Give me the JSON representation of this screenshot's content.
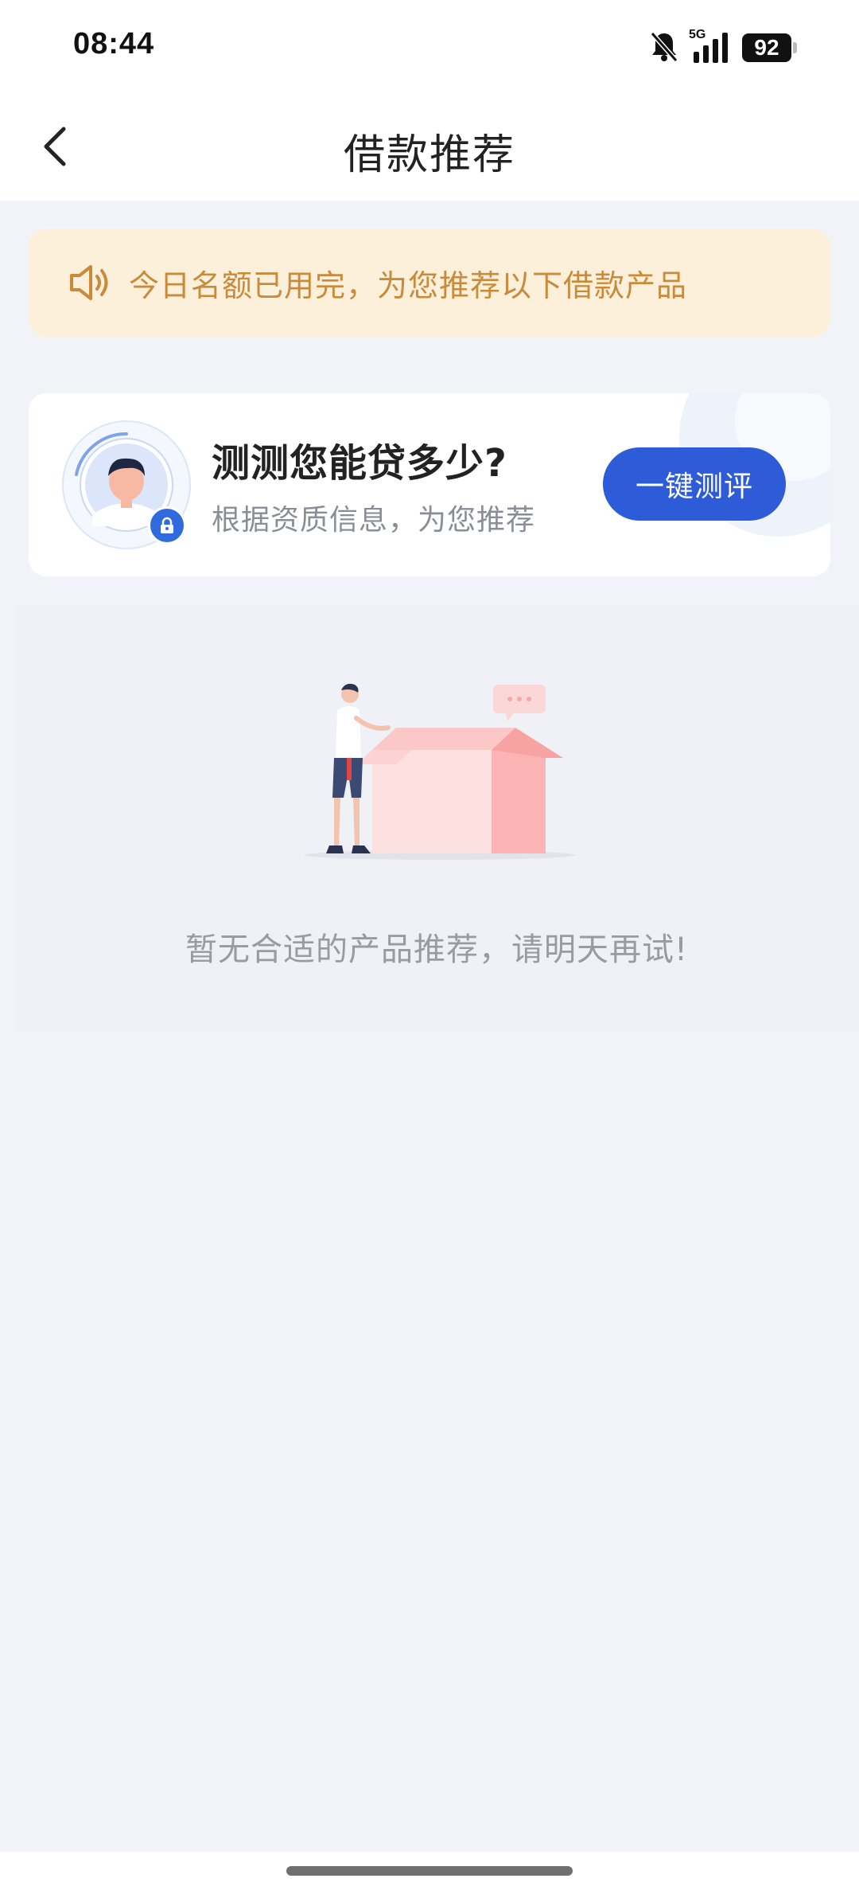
{
  "status_bar": {
    "time": "08:44",
    "network": "5G",
    "battery": "92",
    "icons": [
      "bell-muted-icon",
      "signal-icon",
      "battery-icon"
    ]
  },
  "nav": {
    "title": "借款推荐",
    "back_icon": "chevron-left-icon"
  },
  "notice": {
    "icon": "speaker-icon",
    "text": "今日名额已用完，为您推荐以下借款产品",
    "color": "#c98a3a"
  },
  "assessment": {
    "title": "测测您能贷多少?",
    "subtitle": "根据资质信息，为您推荐",
    "button_label": "一键测评",
    "button_color": "#2e5bd8",
    "avatar_icon": "user-avatar-icon",
    "lock_icon": "lock-icon"
  },
  "empty_state": {
    "illustration": "person-with-box-illustration",
    "message": "暂无合适的产品推荐，请明天再试!"
  }
}
